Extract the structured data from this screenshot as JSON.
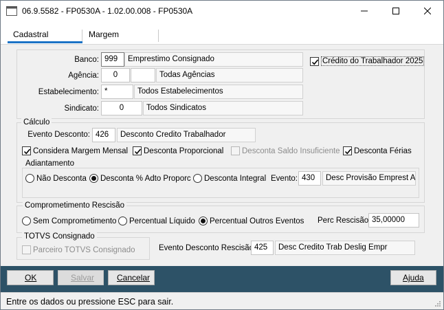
{
  "window": {
    "title": "06.9.5582 - FP0530A - 1.02.00.008 - FP0530A",
    "min_glyph": "—",
    "max_glyph": "☐",
    "close_glyph": "✕"
  },
  "tabs": [
    {
      "label": "Cadastral",
      "active": true
    },
    {
      "label": "Margem",
      "active": false
    }
  ],
  "header": {
    "banco": {
      "label": "Banco:",
      "code": "999",
      "desc": "Emprestimo Consignado"
    },
    "agencia": {
      "label": "Agência:",
      "code": "0",
      "code2": "",
      "desc": "Todas Agências"
    },
    "estabelecimento": {
      "label": "Estabelecimento:",
      "code": "*",
      "desc": "Todos Estabelecimentos"
    },
    "sindicato": {
      "label": "Sindicato:",
      "code": "0",
      "desc": "Todos Sindicatos"
    },
    "credito_trabalhador": {
      "label": "Crédito do Trabalhador 2025",
      "checked": true
    }
  },
  "calculo": {
    "title": "Cálculo",
    "evento_desconto": {
      "label": "Evento Desconto:",
      "code": "426",
      "desc": "Desconto Credito Trabalhador"
    },
    "checks": [
      {
        "label": "Considera Margem Mensal",
        "checked": true,
        "enabled": true
      },
      {
        "label": "Desconta Proporcional",
        "checked": true,
        "enabled": true
      },
      {
        "label": "Desconta Saldo Insuficiente",
        "checked": false,
        "enabled": false
      },
      {
        "label": "Desconta Férias",
        "checked": true,
        "enabled": true
      }
    ],
    "adiantamento": {
      "title": "Adiantamento",
      "options": [
        {
          "label": "Não Desconta",
          "selected": false
        },
        {
          "label": "Desconta % Adto Proporc",
          "selected": true
        },
        {
          "label": "Desconta Integral",
          "selected": false
        }
      ],
      "evento": {
        "label": "Evento:",
        "code": "430",
        "desc": "Desc Provisão Emprest Adt"
      }
    }
  },
  "comprometimento": {
    "title": "Comprometimento Rescisão",
    "options": [
      {
        "label": "Sem Comprometimento",
        "selected": false
      },
      {
        "label": "Percentual Líquido",
        "selected": false
      },
      {
        "label": "Percentual Outros Eventos",
        "selected": true
      }
    ],
    "perc_rescisao": {
      "label": "Perc Rescisão:",
      "value": "35,00000"
    }
  },
  "totvs": {
    "title": "TOTVS Consignado",
    "parceiro": {
      "label": "Parceiro TOTVS Consignado",
      "checked": false,
      "enabled": false
    }
  },
  "evento_rescisao": {
    "label": "Evento Desconto Rescisão:",
    "code": "425",
    "desc": "Desc Credito Trab Deslig Empr"
  },
  "buttons": {
    "ok": "OK",
    "salvar": "Salvar",
    "cancelar": "Cancelar",
    "ajuda": "Ajuda"
  },
  "status": "Entre os dados ou pressione ESC para sair.",
  "colors": {
    "accent": "#1b73c5",
    "bottombar": "#2d5267"
  }
}
